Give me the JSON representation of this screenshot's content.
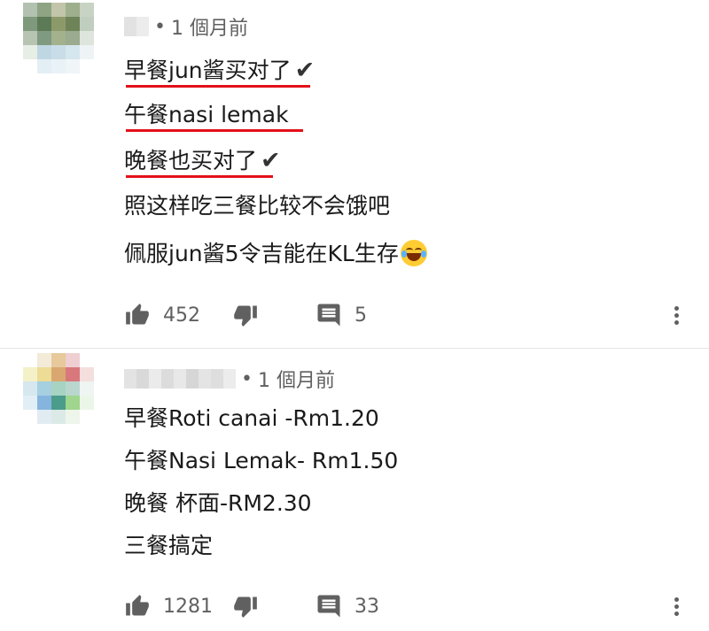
{
  "comments": [
    {
      "timestamp": "1 個月前",
      "lines": [
        "早餐jun酱买对了",
        "午餐nasi lemak",
        "晚餐也买对了",
        "照这样吃三餐比较不会饿吧",
        "佩服jun酱5令吉能在KL生存"
      ],
      "check_mark": "✔",
      "emoji": "face-with-tears-of-joy",
      "likes": "452",
      "replies": "5"
    },
    {
      "timestamp": "1 個月前",
      "lines": [
        "早餐Roti canai -Rm1.20",
        "午餐Nasi Lemak- Rm1.50",
        "晚餐 杯面-RM2.30",
        "三餐搞定"
      ],
      "likes": "1281",
      "replies": "33"
    }
  ],
  "colors": {
    "underline": "#e3101a",
    "secondary_text": "#606060",
    "primary_text": "#1a1a1a"
  },
  "icons": [
    "thumbs-up-icon",
    "thumbs-down-icon",
    "reply-comment-icon",
    "more-vert-icon"
  ]
}
